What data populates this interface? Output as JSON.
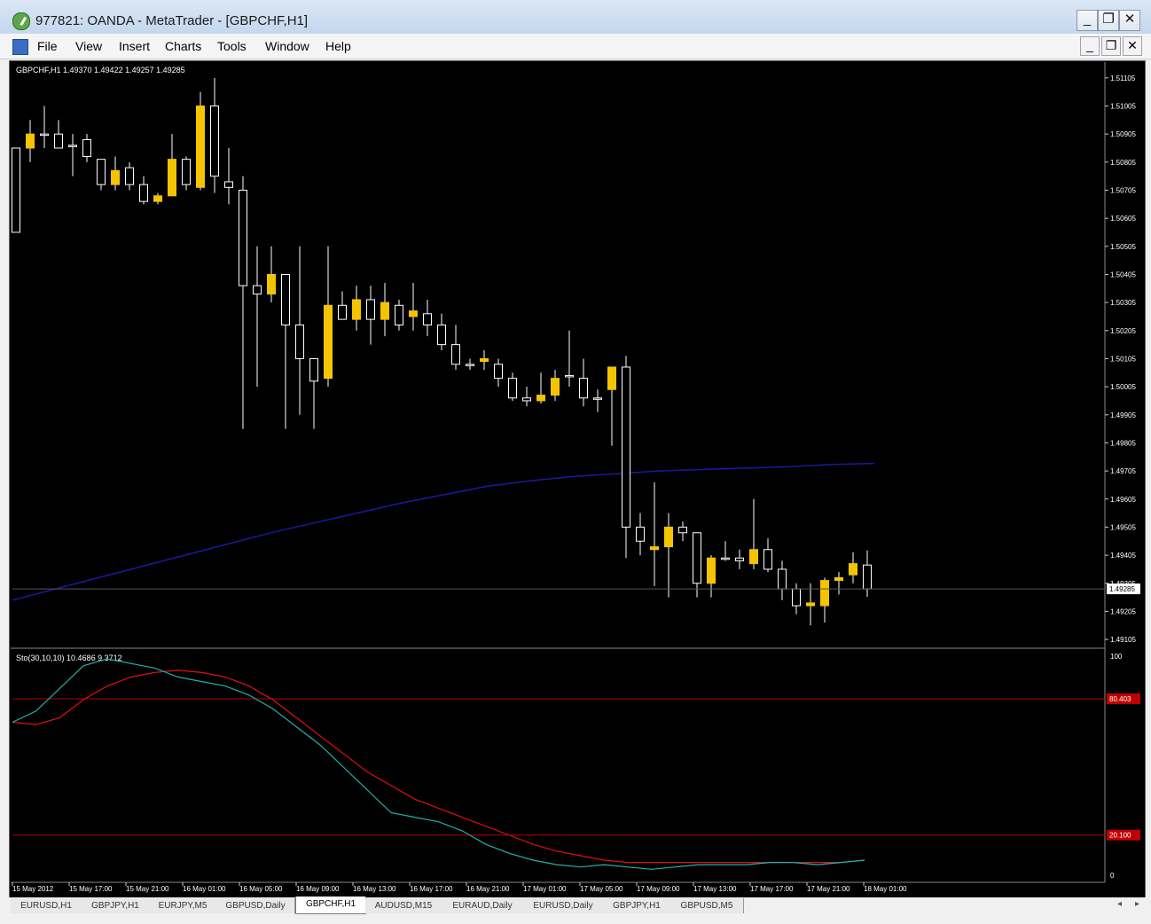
{
  "window": {
    "title": "977821: OANDA - MetaTrader - [GBPCHF,H1]",
    "controls": [
      "_",
      "❐",
      "✕"
    ]
  },
  "menu": [
    "File",
    "View",
    "Insert",
    "Charts",
    "Tools",
    "Window",
    "Help"
  ],
  "chart": {
    "symbol_info": "GBPCHF,H1  1.49370 1.49422 1.49257 1.49285",
    "price_labels": [
      "1.51105",
      "1.51005",
      "1.50905",
      "1.50805",
      "1.50705",
      "1.50605",
      "1.50505",
      "1.50405",
      "1.50305",
      "1.50205",
      "1.50105",
      "1.50005",
      "1.49905",
      "1.49805",
      "1.49705",
      "1.49605",
      "1.49505",
      "1.49405",
      "1.49305",
      "1.49205",
      "1.49105"
    ],
    "current_price": "1.49285",
    "time_labels": [
      "15 May 2012",
      "15 May 17:00",
      "15 May 21:00",
      "16 May 01:00",
      "16 May 05:00",
      "16 May 09:00",
      "16 May 13:00",
      "16 May 17:00",
      "16 May 21:00",
      "17 May 01:00",
      "17 May 05:00",
      "17 May 09:00",
      "17 May 13:00",
      "17 May 17:00",
      "17 May 21:00",
      "18 May 01:00"
    ],
    "colors": {
      "bull": "#f5c400",
      "bear": "#000000",
      "wick": "#ffffff",
      "ma": "#1a1aa0",
      "grid": "#2a2a2a",
      "main_line": "#20b2aa",
      "signal_line": "#e01010",
      "level": "#b00000"
    },
    "candles": [
      [
        1.50855,
        1.50855,
        1.50555,
        1.50555
      ],
      [
        1.50855,
        1.50955,
        1.50805,
        1.50905
      ],
      [
        1.50905,
        1.51005,
        1.50855,
        1.50905
      ],
      [
        1.50905,
        1.50955,
        1.50855,
        1.50855
      ],
      [
        1.50865,
        1.50905,
        1.50755,
        1.50865
      ],
      [
        1.50885,
        1.50905,
        1.50805,
        1.50825
      ],
      [
        1.50815,
        1.50815,
        1.50705,
        1.50725
      ],
      [
        1.50725,
        1.50825,
        1.50705,
        1.50775
      ],
      [
        1.50785,
        1.50805,
        1.50705,
        1.50725
      ],
      [
        1.50725,
        1.50755,
        1.50655,
        1.50665
      ],
      [
        1.50665,
        1.50695,
        1.50655,
        1.50685
      ],
      [
        1.50685,
        1.50905,
        1.50685,
        1.50815
      ],
      [
        1.50815,
        1.50825,
        1.50705,
        1.50725
      ],
      [
        1.50715,
        1.51055,
        1.50705,
        1.51005
      ],
      [
        1.51005,
        1.51105,
        1.50695,
        1.50755
      ],
      [
        1.50735,
        1.50855,
        1.50655,
        1.50715
      ],
      [
        1.50705,
        1.50755,
        1.49855,
        1.50365
      ],
      [
        1.50365,
        1.50505,
        1.50005,
        1.50335
      ],
      [
        1.50335,
        1.50505,
        1.50305,
        1.50405
      ],
      [
        1.50405,
        1.50405,
        1.49855,
        1.50225
      ],
      [
        1.50225,
        1.50505,
        1.49905,
        1.50105
      ],
      [
        1.50105,
        1.50105,
        1.49855,
        1.50025
      ],
      [
        1.50035,
        1.50505,
        1.50005,
        1.50295
      ],
      [
        1.50295,
        1.50345,
        1.50245,
        1.50245
      ],
      [
        1.50245,
        1.50365,
        1.50205,
        1.50315
      ],
      [
        1.50315,
        1.50365,
        1.50155,
        1.50245
      ],
      [
        1.50245,
        1.50375,
        1.50185,
        1.50305
      ],
      [
        1.50295,
        1.50315,
        1.50205,
        1.50225
      ],
      [
        1.50255,
        1.50375,
        1.50205,
        1.50275
      ],
      [
        1.50265,
        1.50315,
        1.50185,
        1.50225
      ],
      [
        1.50225,
        1.50265,
        1.50135,
        1.50155
      ],
      [
        1.50155,
        1.50225,
        1.50065,
        1.50085
      ],
      [
        1.50085,
        1.50105,
        1.50065,
        1.50085
      ],
      [
        1.50095,
        1.50135,
        1.50065,
        1.50105
      ],
      [
        1.50085,
        1.50105,
        1.50005,
        1.50035
      ],
      [
        1.50035,
        1.50055,
        1.49955,
        1.49965
      ],
      [
        1.49965,
        1.50005,
        1.49935,
        1.49955
      ],
      [
        1.49955,
        1.50055,
        1.49945,
        1.49975
      ],
      [
        1.49975,
        1.50065,
        1.49955,
        1.50035
      ],
      [
        1.50045,
        1.50205,
        1.50005,
        1.50045
      ],
      [
        1.50035,
        1.50105,
        1.49935,
        1.49965
      ],
      [
        1.49965,
        1.49995,
        1.49915,
        1.49965
      ],
      [
        1.49995,
        1.50075,
        1.49795,
        1.50075
      ],
      [
        1.50075,
        1.50115,
        1.49395,
        1.49505
      ],
      [
        1.49505,
        1.49555,
        1.49405,
        1.49455
      ],
      [
        1.49425,
        1.49665,
        1.49295,
        1.49435
      ],
      [
        1.49435,
        1.49555,
        1.49255,
        1.49505
      ],
      [
        1.49505,
        1.49525,
        1.49455,
        1.49485
      ],
      [
        1.49485,
        1.49485,
        1.49255,
        1.49305
      ],
      [
        1.49305,
        1.49405,
        1.49255,
        1.49395
      ],
      [
        1.49395,
        1.49455,
        1.49385,
        1.49395
      ],
      [
        1.49395,
        1.49425,
        1.49355,
        1.49385
      ],
      [
        1.49375,
        1.49605,
        1.49355,
        1.49425
      ],
      [
        1.49425,
        1.49465,
        1.49345,
        1.49355
      ],
      [
        1.49355,
        1.49385,
        1.49245,
        1.49285
      ],
      [
        1.49285,
        1.49305,
        1.49195,
        1.49225
      ],
      [
        1.49225,
        1.49305,
        1.49155,
        1.49235
      ],
      [
        1.49225,
        1.49325,
        1.49165,
        1.49315
      ],
      [
        1.49315,
        1.49345,
        1.49265,
        1.49325
      ],
      [
        1.49335,
        1.49415,
        1.49305,
        1.49375
      ],
      [
        1.4937,
        1.49422,
        1.49257,
        1.49285
      ]
    ],
    "ma": [
      1.49245,
      1.49285,
      1.49325,
      1.49365,
      1.49405,
      1.49445,
      1.49485,
      1.4952,
      1.49555,
      1.4959,
      1.4962,
      1.4965,
      1.4967,
      1.49685,
      1.49695,
      1.49705,
      1.4971,
      1.49715,
      1.4972,
      1.49728,
      1.49732
    ],
    "stochastic": {
      "label": "Sto(30,10,10) 10.4686 9.3712",
      "scale_top": "100",
      "scale_bottom": "0",
      "level_high": "80.403",
      "level_low": "20.100",
      "main": [
        70,
        75,
        85,
        95,
        98,
        96,
        94,
        90,
        88,
        86,
        82,
        76,
        68,
        60,
        50,
        40,
        30,
        28,
        26,
        22,
        16,
        12,
        9,
        7,
        6,
        7,
        6,
        5,
        6,
        7,
        7,
        7,
        8,
        8,
        7,
        8,
        9
      ],
      "signal": [
        70,
        69,
        72,
        80,
        86,
        90,
        92,
        93,
        92,
        90,
        86,
        80,
        72,
        64,
        56,
        48,
        42,
        36,
        32,
        28,
        24,
        20,
        16,
        13,
        11,
        9,
        8,
        8,
        8,
        8,
        8,
        8,
        8,
        8,
        8,
        8,
        9
      ]
    }
  },
  "tabs": [
    "EURUSD,H1",
    "GBPJPY,H1",
    "EURJPY,M5",
    "GBPUSD,Daily",
    "GBPCHF,H1",
    "AUDUSD,M15",
    "EURAUD,Daily",
    "EURUSD,Daily",
    "GBPJPY,H1",
    "GBPUSD,M5"
  ],
  "active_tab": 4,
  "scroll_arrows": [
    "◂",
    "▸"
  ]
}
